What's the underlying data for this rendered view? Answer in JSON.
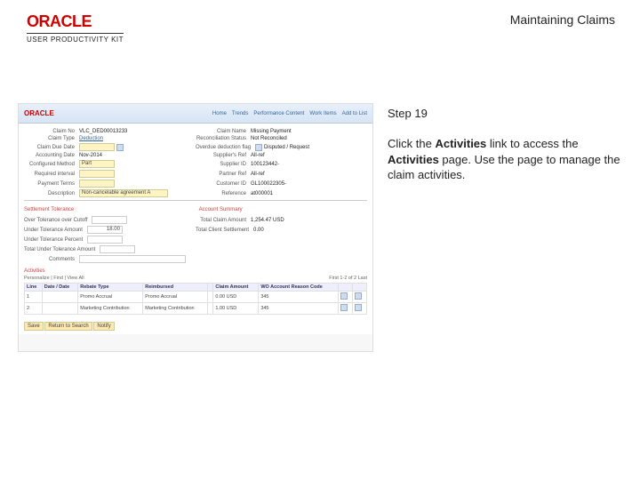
{
  "header": {
    "brand": "ORACLE",
    "brand_sub": "USER PRODUCTIVITY KIT",
    "doc_title": "Maintaining Claims"
  },
  "step": {
    "title": "Step 19",
    "body_parts": {
      "p1a": "Click the ",
      "p1b": "Activities",
      "p1c": " link to access the ",
      "p1d": "Activities",
      "p1e": " page. Use the page to manage the claim activities."
    }
  },
  "ss": {
    "logo": "ORACLE",
    "toplinks": [
      "Home",
      "Trends",
      "Performance Content",
      "Work Items",
      "Add to List"
    ],
    "hdr1": {
      "claim_no_lbl": "Claim No",
      "claim_no": "VLC_DED00013233",
      "name_lbl": "Claim Name",
      "name": "Missing Payment"
    },
    "hdr2": {
      "type_lbl": "Claim Type",
      "type": "Deduction",
      "recon_lbl": "Reconciliation Status",
      "recon": "Not Reconciled"
    },
    "hdr3": {
      "due_lbl": "Claim Due Date",
      "due": "",
      "overdue_lbl": "Overdue deduction flag",
      "overdue": "Disputed / Request"
    },
    "hdr4": {
      "acct_lbl": "Accounting Date",
      "acct": "Nov-2014",
      "supp_lbl": "Supplier's Ref",
      "supp": "All-ref"
    },
    "hdr5": {
      "method_lbl": "Configured Method",
      "method": "Part",
      "suppid_lbl": "Supplier ID",
      "suppid": "100123442-"
    },
    "hdr6": {
      "elig_lbl": "Required interval",
      "elig": "",
      "partref_lbl": "Partner Ref",
      "partref": "All-ref"
    },
    "hdr7": {
      "payterm_lbl": "Payment Terms",
      "payterm": "",
      "cust_lbl": "Customer ID",
      "cust": "GL100022305-"
    },
    "hdr8": {
      "desc_lbl": "Description",
      "desc": "Non-cancelable agreement A",
      "ref_lbl": "Reference",
      "ref": "at000001"
    },
    "tab1": "Settlement Tolerance",
    "tab2": "Account Summary",
    "st": {
      "otc_lbl": "Over Tolerance over Cutoff",
      "otc": "",
      "under_amt_lbl": "Under Tolerance Amount",
      "under_amt": "18.00",
      "under_pct_lbl": "Under Tolerance Percent",
      "under_pct": "",
      "tunder_lbl": "Total Under Tolerance Amount",
      "tunder": "",
      "comments_lbl": "Comments",
      "comments": ""
    },
    "acct": {
      "total_amt_lbl": "Total Claim Amount",
      "total_amt": "1,254.47  USD",
      "settle_lbl": "Total Client Settlement",
      "settle": "0.00"
    },
    "activities": "Activities",
    "table": {
      "cols": [
        "Line",
        "Date / Date",
        "Rebate Type",
        "Reimbursed",
        "",
        "Claim Amount",
        "WO Account Reason Code",
        "",
        ""
      ],
      "r1": [
        "1",
        "",
        "Promo Accrual",
        "Promo Accrual",
        "",
        "0.00  USD",
        "345",
        "",
        ""
      ],
      "r2": [
        "2",
        "",
        "Marketing Contribution",
        "Marketing Contribution",
        "",
        "1.00  USD",
        "345",
        "",
        ""
      ]
    },
    "subhdr_l": "Personalize | Find | View All",
    "subhdr_r": "First 1-2 of 2 Last",
    "save": "Save",
    "ret": "Return to Search",
    "notify": "Notify"
  }
}
